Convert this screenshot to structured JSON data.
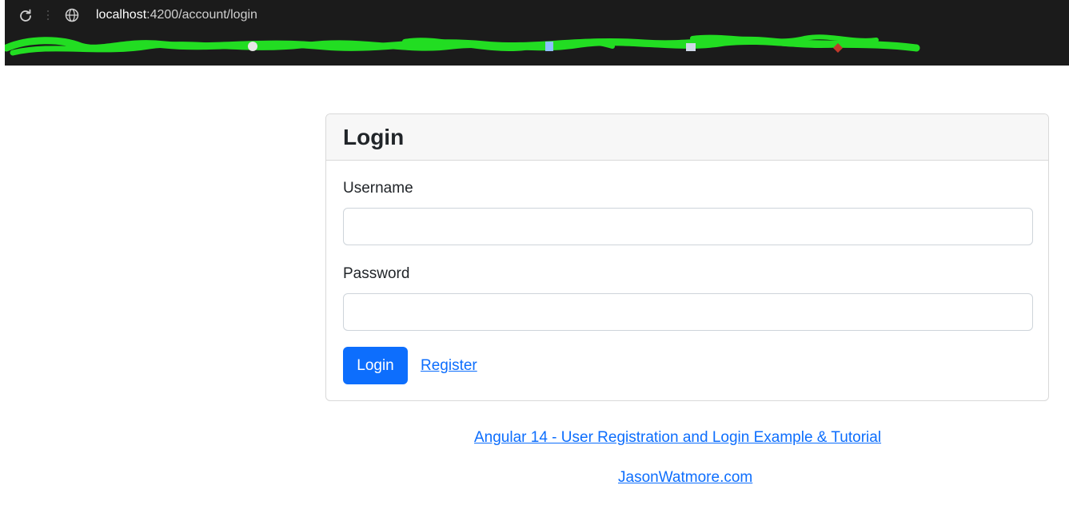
{
  "browser": {
    "url_host": "localhost",
    "url_path": ":4200/account/login"
  },
  "login_card": {
    "title": "Login",
    "username_label": "Username",
    "username_value": "",
    "password_label": "Password",
    "password_value": "",
    "login_button": "Login",
    "register_link": "Register"
  },
  "footer": {
    "tutorial_link": "Angular 14 - User Registration and Login Example & Tutorial",
    "site_link": "JasonWatmore.com"
  },
  "colors": {
    "primary": "#0d6efd",
    "scribble": "#22dd22",
    "toolbar": "#1b1b1b"
  }
}
